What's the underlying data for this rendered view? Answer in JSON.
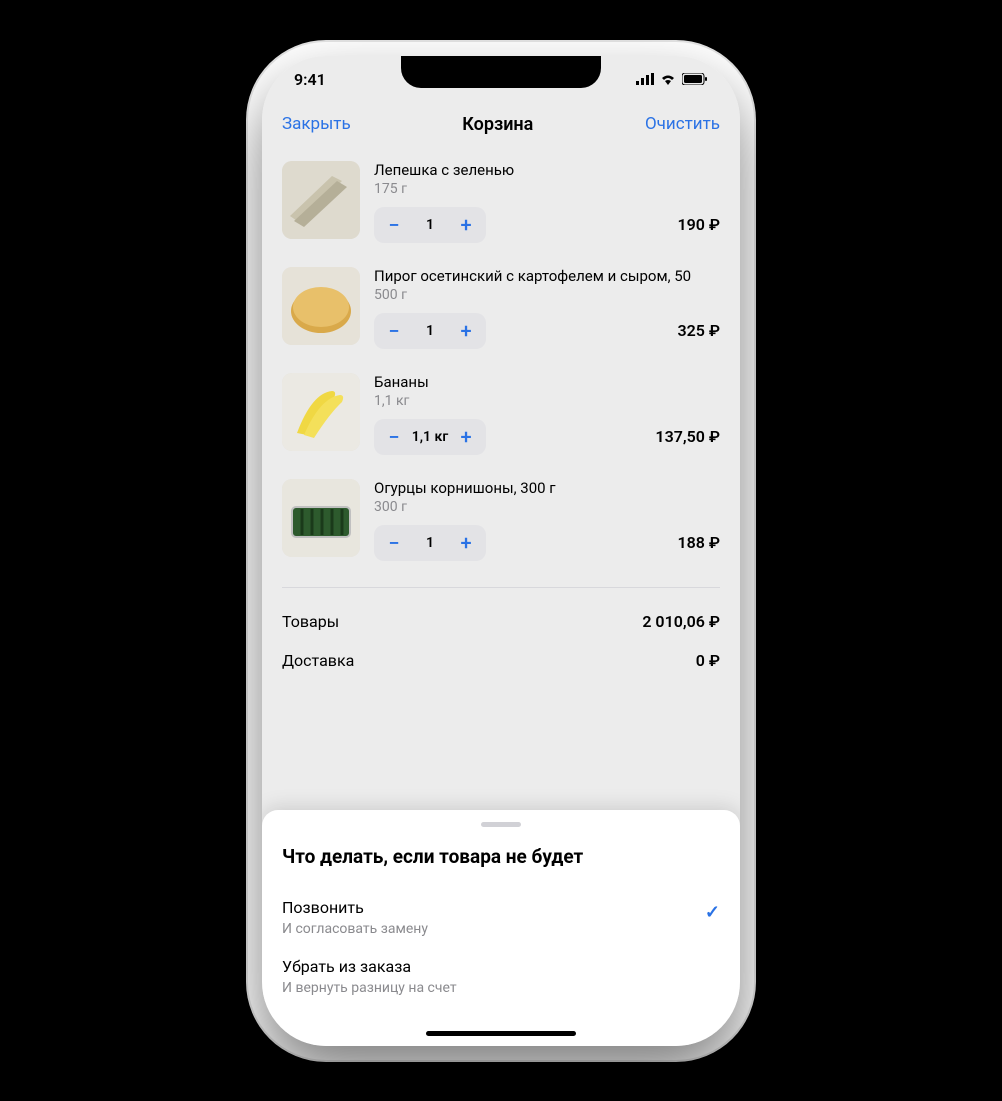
{
  "status": {
    "time": "9:41"
  },
  "nav": {
    "close": "Закрыть",
    "title": "Корзина",
    "clear": "Очистить"
  },
  "items": [
    {
      "name": "Лепешка с зеленью",
      "weight": "175 г",
      "qty": "1",
      "price": "190 ₽"
    },
    {
      "name": "Пирог осетинский с картофелем и сыром, 50",
      "weight": "500 г",
      "qty": "1",
      "price": "325 ₽"
    },
    {
      "name": "Бананы",
      "weight": "1,1 кг",
      "qty": "1,1 кг",
      "price": "137,50 ₽"
    },
    {
      "name": "Огурцы корнишоны, 300 г",
      "weight": "300 г",
      "qty": "1",
      "price": "188 ₽"
    }
  ],
  "summary": {
    "goods_label": "Товары",
    "goods_value": "2 010,06 ₽",
    "delivery_label": "Доставка",
    "delivery_value": "0 ₽"
  },
  "sheet": {
    "title": "Что делать, если товара не будет",
    "options": [
      {
        "title": "Позвонить",
        "sub": "И согласовать замену",
        "selected": true
      },
      {
        "title": "Убрать из заказа",
        "sub": "И вернуть разницу на счет",
        "selected": false
      }
    ]
  },
  "stepper": {
    "minus": "−",
    "plus": "+"
  }
}
